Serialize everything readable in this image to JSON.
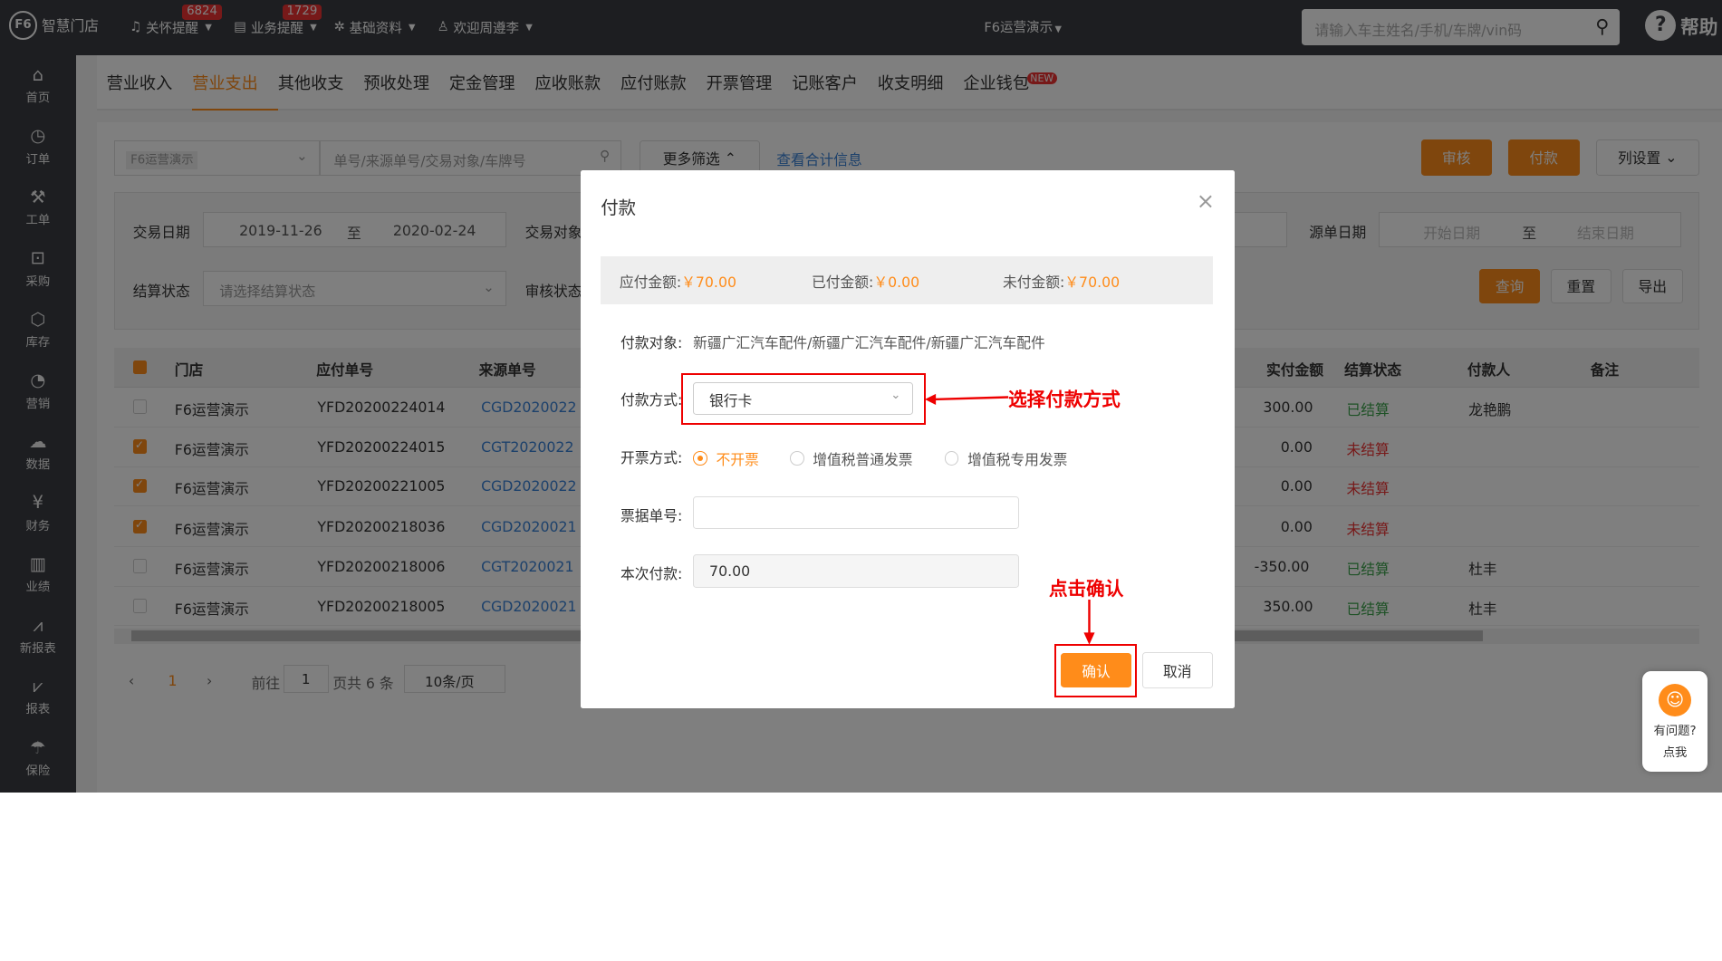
{
  "topbar": {
    "logo_text": "智慧门店",
    "nav": [
      {
        "label": "关怀提醒",
        "badge": "6824",
        "icon": "bell-icon"
      },
      {
        "label": "业务提醒",
        "badge": "1729",
        "icon": "document-icon"
      },
      {
        "label": "基础资料",
        "icon": "gear-icon"
      },
      {
        "label": "欢迎周遵李",
        "icon": "user-icon"
      }
    ],
    "store": "F6运营演示",
    "search_placeholder": "请输入车主姓名/手机/车牌/vin码",
    "help": "帮助"
  },
  "sidebar": [
    {
      "label": "首页",
      "icon": "home-icon"
    },
    {
      "label": "订单",
      "icon": "clock-icon"
    },
    {
      "label": "工单",
      "icon": "wrench-icon"
    },
    {
      "label": "采购",
      "icon": "cart-icon"
    },
    {
      "label": "库存",
      "icon": "box-icon"
    },
    {
      "label": "营销",
      "icon": "pie-icon"
    },
    {
      "label": "数据",
      "icon": "cloud-icon"
    },
    {
      "label": "财务",
      "icon": "yen-icon"
    },
    {
      "label": "业绩",
      "icon": "bar-chart-icon"
    },
    {
      "label": "新报表",
      "icon": "line-chart-icon"
    },
    {
      "label": "报表",
      "icon": "report-icon"
    },
    {
      "label": "保险",
      "icon": "umbrella-icon"
    }
  ],
  "tabs": [
    "营业收入",
    "营业支出",
    "其他收支",
    "预收处理",
    "定金管理",
    "应收账款",
    "应付账款",
    "开票管理",
    "记账客户",
    "收支明细",
    "企业钱包"
  ],
  "tab_new_badge": "NEW",
  "toolbar": {
    "store_tag": "F6运营演示",
    "search_placeholder": "单号/来源单号/交易对象/车牌号",
    "more_filter": "更多筛选",
    "view_total": "查看合计信息",
    "audit": "审核",
    "pay": "付款",
    "columns": "列设置"
  },
  "filters": {
    "trade_date_label": "交易日期",
    "date_from": "2019-11-26",
    "to": "至",
    "date_to": "2020-02-24",
    "trade_obj_label": "交易对象",
    "source_date_label": "源单日期",
    "start_date_ph": "开始日期",
    "end_date_ph": "结束日期",
    "settle_label": "结算状态",
    "settle_ph": "请选择结算状态",
    "audit_label": "审核状态",
    "query": "查询",
    "reset": "重置",
    "export": "导出"
  },
  "table": {
    "headers": [
      "门店",
      "应付单号",
      "来源单号",
      "实付金额",
      "结算状态",
      "付款人",
      "备注"
    ],
    "rows": [
      {
        "checked": false,
        "store": "F6运营演示",
        "no": "YFD20200224014",
        "src": "CGD2020022",
        "paid": "300.00",
        "status": "已结算",
        "payer": "龙艳鹏"
      },
      {
        "checked": true,
        "store": "F6运营演示",
        "no": "YFD20200224015",
        "src": "CGT2020022",
        "paid": "0.00",
        "status": "未结算",
        "payer": ""
      },
      {
        "checked": true,
        "store": "F6运营演示",
        "no": "YFD20200221005",
        "src": "CGD2020022",
        "paid": "0.00",
        "status": "未结算",
        "payer": ""
      },
      {
        "checked": true,
        "store": "F6运营演示",
        "no": "YFD20200218036",
        "src": "CGD2020021",
        "paid": "0.00",
        "status": "未结算",
        "payer": ""
      },
      {
        "checked": false,
        "store": "F6运营演示",
        "no": "YFD20200218006",
        "src": "CGT2020021",
        "paid": "-350.00",
        "status": "已结算",
        "payer": "杜丰"
      },
      {
        "checked": false,
        "store": "F6运营演示",
        "no": "YFD20200218005",
        "src": "CGD2020021",
        "paid": "350.00",
        "status": "已结算",
        "payer": "杜丰"
      }
    ]
  },
  "pager": {
    "prev": "‹",
    "page": "1",
    "next": "›",
    "goto": "前往",
    "goto_value": "1",
    "total": "页共 6 条",
    "size": "10条/页"
  },
  "modal": {
    "title": "付款",
    "payable_label": "应付金额:",
    "payable": "￥70.00",
    "paid_label": "已付金额:",
    "paid": "￥0.00",
    "unpaid_label": "未付金额:",
    "unpaid": "￥70.00",
    "target_label": "付款对象:",
    "target": "新疆广汇汽车配件/新疆广汇汽车配件/新疆广汇汽车配件",
    "method_label": "付款方式:",
    "method": "银行卡",
    "invoice_label": "开票方式:",
    "invoice_options": [
      "不开票",
      "增值税普通发票",
      "增值税专用发票"
    ],
    "receipt_label": "票据单号:",
    "receipt": "",
    "amount_label": "本次付款:",
    "amount": "70.00",
    "ok": "确认",
    "cancel": "取消"
  },
  "annotations": {
    "select_method": "选择付款方式",
    "click_ok": "点击确认"
  },
  "help_widget": {
    "line1": "有问题?",
    "line2": "点我"
  },
  "colors": {
    "accent": "#ff8c1a",
    "topbar": "#3a3d42",
    "annotation": "#e00000"
  }
}
